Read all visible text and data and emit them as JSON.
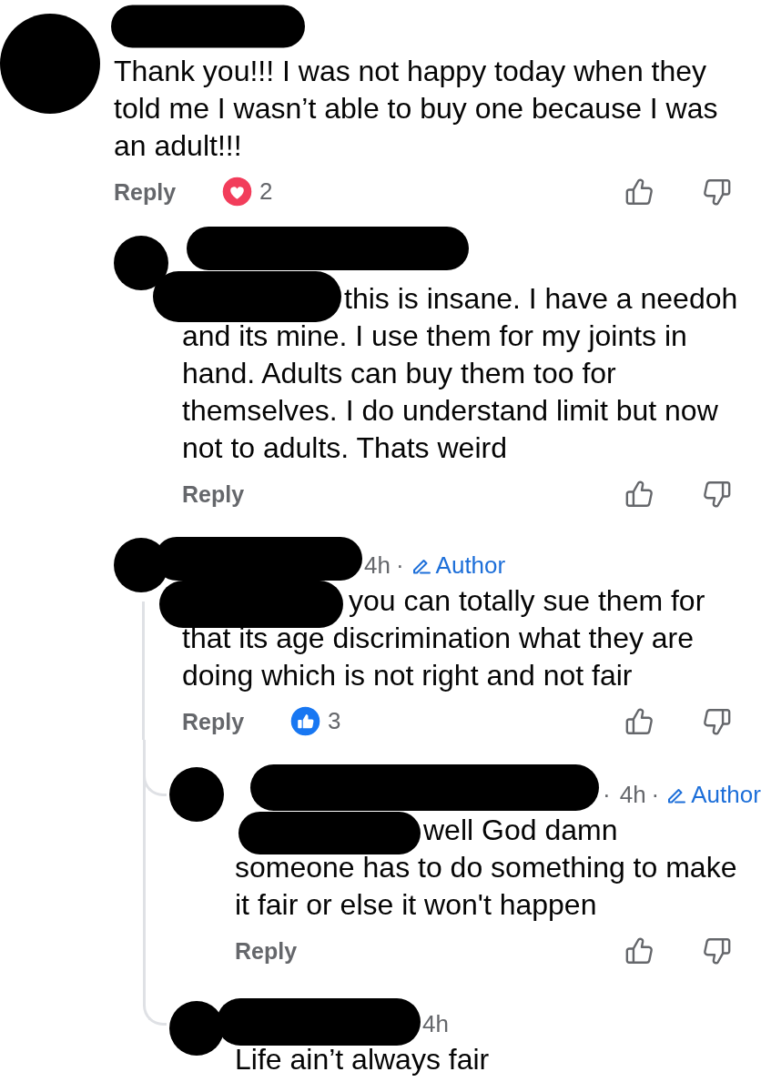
{
  "comments": [
    {
      "name_redacted": true,
      "text": "Thank you!!! I was not happy today when they told me I wasn’t able to buy one because I was an adult!!!",
      "reply_label": "Reply",
      "reaction": {
        "kind": "love",
        "count": "2"
      },
      "children": [
        {
          "name_redacted": true,
          "mention_redacted": true,
          "text": "this is insane. I have a needoh and its mine. I use them for my joints in hand. Adults can buy them too for themselves. I do understand limit but now not to adults. Thats weird",
          "reply_label": "Reply"
        },
        {
          "name_redacted": true,
          "mention_redacted": true,
          "time": "4h",
          "separator": "·",
          "badge": "Author",
          "text": "you can totally sue them for that its age discrimination what they are doing which is not right and not fair",
          "reply_label": "Reply",
          "reaction": {
            "kind": "like",
            "count": "3"
          },
          "children": [
            {
              "name_redacted": true,
              "mention_redacted": true,
              "lead_separator": "·",
              "time": "4h",
              "separator": "·",
              "badge": "Author",
              "text": "well God damn someone has to do something to make it fair or else it won't happen",
              "reply_label": "Reply"
            },
            {
              "name_redacted": true,
              "time": "4h",
              "text": "Life ain’t always fair"
            }
          ]
        }
      ]
    }
  ]
}
